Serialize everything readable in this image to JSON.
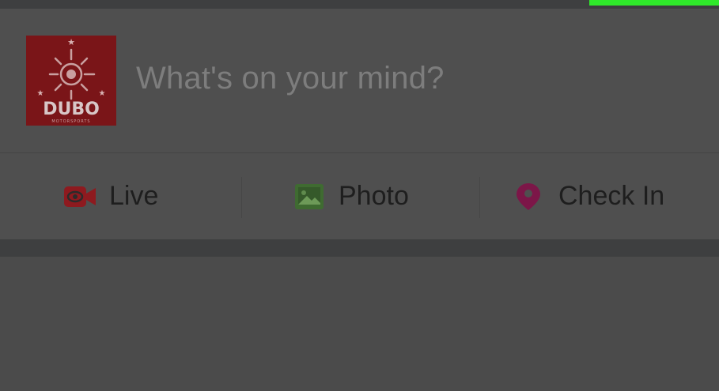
{
  "composer": {
    "avatar_text": "DUBO",
    "avatar_subtext": "MOTORSPORTS",
    "placeholder": "What's on your mind?"
  },
  "actions": [
    {
      "label": "Live",
      "icon": "live-video-icon",
      "icon_color": "#8e1a1f"
    },
    {
      "label": "Photo",
      "icon": "photo-icon",
      "icon_color": "#3f6b31"
    },
    {
      "label": "Check In",
      "icon": "location-pin-icon",
      "icon_color": "#7c1648"
    }
  ],
  "colors": {
    "progress_accent": "#2fe82a",
    "avatar_bg": "#7a1518"
  }
}
